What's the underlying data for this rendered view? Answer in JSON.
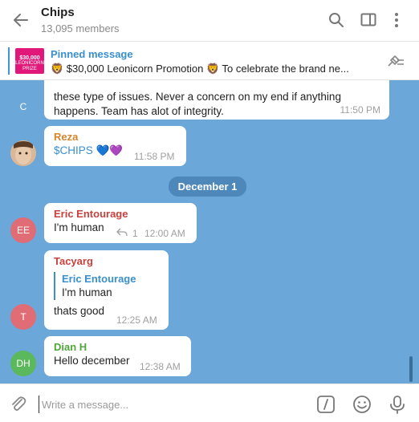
{
  "header": {
    "title": "Chips",
    "subtitle": "13,095 members"
  },
  "pinned": {
    "title": "Pinned message",
    "thumb_text": "$30,000",
    "thumb_sub": "LEONICORN PRIZE",
    "text": "🦁 $30,000 Leonicorn Promotion 🦁  To celebrate the brand ne..."
  },
  "messages": {
    "m1": {
      "avatar": "C",
      "avatar_color": "#e06c75",
      "lines": [
        "these type of issues. Never a concern on my end if anything",
        "happens. Team has alot of integrity."
      ],
      "time": "11:50 PM"
    },
    "m2": {
      "name": "Reza",
      "name_color": "#d8842a",
      "text": "$CHIPS 💙💜",
      "time": "11:58 PM"
    },
    "date": "December 1",
    "m3": {
      "avatar": "EE",
      "avatar_color": "#e06c75",
      "name": "Eric Entourage",
      "name_color": "#c9413d",
      "text": "I'm human",
      "reply_count": "1",
      "time": "12:00 AM"
    },
    "m4": {
      "avatar": "T",
      "avatar_color": "#e06c75",
      "name": "Tacyarg",
      "name_color": "#c9413d",
      "quote_name": "Eric Entourage",
      "quote_text": "I'm human",
      "text": "thats good",
      "time": "12:25 AM"
    },
    "m5": {
      "avatar": "DH",
      "avatar_color": "#5cb85c",
      "name": "Dian H",
      "name_color": "#4ea63a",
      "text": "Hello december",
      "time": "12:38 AM"
    }
  },
  "compose": {
    "placeholder": "Write a message..."
  },
  "colors": {
    "accent": "#3a8fce",
    "chat_bg": "#6ba7d8"
  }
}
